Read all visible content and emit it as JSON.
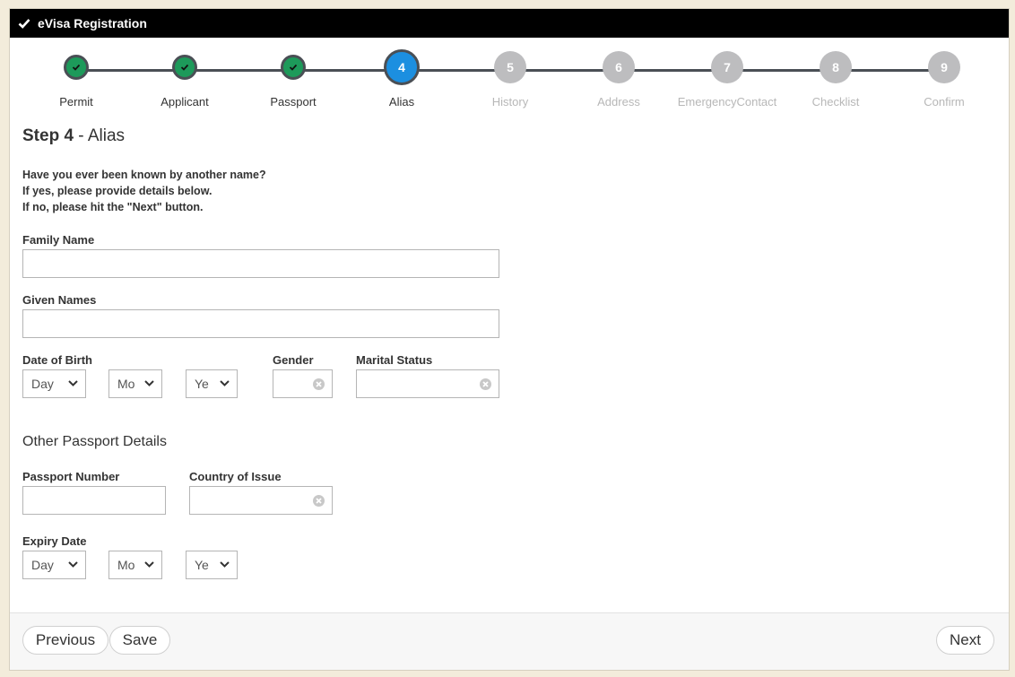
{
  "titlebar": {
    "title": "eVisa Registration",
    "icon": "checkmark-icon"
  },
  "steps": [
    {
      "number": "1",
      "label": "Permit",
      "state": "done"
    },
    {
      "number": "2",
      "label": "Applicant",
      "state": "done"
    },
    {
      "number": "3",
      "label": "Passport",
      "state": "done"
    },
    {
      "number": "4",
      "label": "Alias",
      "state": "active"
    },
    {
      "number": "5",
      "label": "History",
      "state": "todo"
    },
    {
      "number": "6",
      "label": "Address",
      "state": "todo"
    },
    {
      "number": "7",
      "label": "EmergencyContact",
      "state": "todo"
    },
    {
      "number": "8",
      "label": "Checklist",
      "state": "todo"
    },
    {
      "number": "9",
      "label": "Confirm",
      "state": "todo"
    }
  ],
  "heading": {
    "step": "Step 4",
    "rest": " - Alias"
  },
  "intro": {
    "line1": "Have you ever been known by another name?",
    "line2": "If yes, please provide details below.",
    "line3": "If no, please hit the \"Next\" button."
  },
  "form": {
    "family_name_label": "Family Name",
    "family_name_value": "",
    "given_names_label": "Given Names",
    "given_names_value": "",
    "dob_label": "Date of Birth",
    "dob_day": "Day",
    "dob_month": "Mo",
    "dob_year": "Ye",
    "gender_label": "Gender",
    "gender_value": "",
    "marital_label": "Marital Status",
    "marital_value": "",
    "other_passport_title": "Other Passport Details",
    "passport_number_label": "Passport Number",
    "passport_number_value": "",
    "country_label": "Country of Issue",
    "country_value": "",
    "expiry_label": "Expiry Date",
    "expiry_day": "Day",
    "expiry_month": "Mo",
    "expiry_year": "Ye"
  },
  "footer": {
    "previous": "Previous",
    "save": "Save",
    "next": "Next"
  },
  "colors": {
    "done": "#1d9a5a",
    "active": "#1c8fe0",
    "todo": "#bdbdbf",
    "titlebar": "#000000",
    "page_bg": "#f3ecdb"
  }
}
